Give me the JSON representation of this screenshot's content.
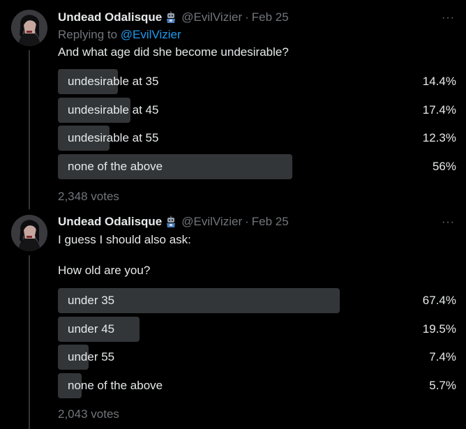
{
  "tweets": [
    {
      "display_name": "Undead Odalisque",
      "handle": "@EvilVizier",
      "dot": "·",
      "date": "Feb 25",
      "more": "···",
      "replying_prefix": "Replying to",
      "replying_mention": "@EvilVizier",
      "text": "And what age did she become undesirable?",
      "poll": [
        {
          "label": "undesirable at 35",
          "pct_text": "14.4%",
          "pct": 14.4
        },
        {
          "label": "undesirable at 45",
          "pct_text": "17.4%",
          "pct": 17.4
        },
        {
          "label": "undesirable at 55",
          "pct_text": "12.3%",
          "pct": 12.3
        },
        {
          "label": "none of the above",
          "pct_text": "56%",
          "pct": 56
        }
      ],
      "votes": "2,348 votes"
    },
    {
      "display_name": "Undead Odalisque",
      "handle": "@EvilVizier",
      "dot": "·",
      "date": "Feb 25",
      "more": "···",
      "text_line1": "I guess I should also ask:",
      "text_line2": "How old are you?",
      "poll": [
        {
          "label": "under 35",
          "pct_text": "67.4%",
          "pct": 67.4
        },
        {
          "label": "under 45",
          "pct_text": "19.5%",
          "pct": 19.5
        },
        {
          "label": "under 55",
          "pct_text": "7.4%",
          "pct": 7.4
        },
        {
          "label": "none of the above",
          "pct_text": "5.7%",
          "pct": 5.7
        }
      ],
      "votes": "2,043 votes"
    }
  ],
  "colors": {
    "background": "#000000",
    "text_primary": "#e7e9ea",
    "text_secondary": "#71767b",
    "link": "#1d9bf0",
    "poll_bar": "#333639",
    "thread_line": "#333639"
  },
  "icons": {
    "avatar": "avatar-image",
    "badge": "robot-badge-icon",
    "more": "more-options-icon"
  }
}
